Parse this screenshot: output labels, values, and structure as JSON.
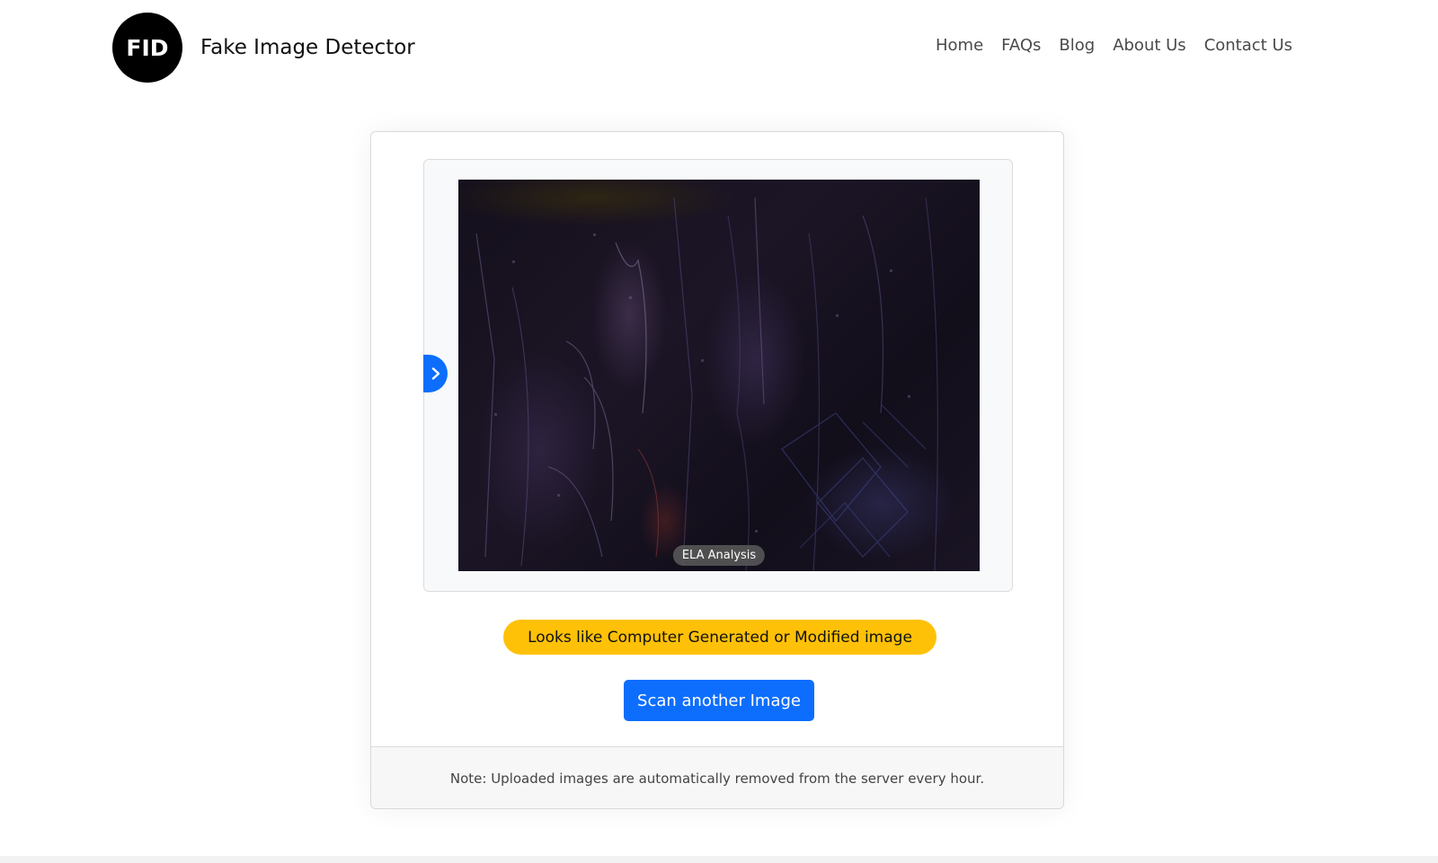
{
  "brand": {
    "logo_text": "FID",
    "name": "Fake Image Detector"
  },
  "nav": {
    "items": [
      {
        "label": "Home"
      },
      {
        "label": "FAQs"
      },
      {
        "label": "Blog"
      },
      {
        "label": "About Us"
      },
      {
        "label": "Contact Us"
      }
    ]
  },
  "viewer": {
    "image_label": "ELA Analysis",
    "toggle_icon": "chevron-right-icon"
  },
  "result": {
    "text": "Looks like Computer Generated or Modified image",
    "color": "#ffc107"
  },
  "actions": {
    "scan_label": "Scan another Image",
    "color": "#0d6efd"
  },
  "footer": {
    "note": "Note: Uploaded images are automatically removed from the server every hour."
  }
}
